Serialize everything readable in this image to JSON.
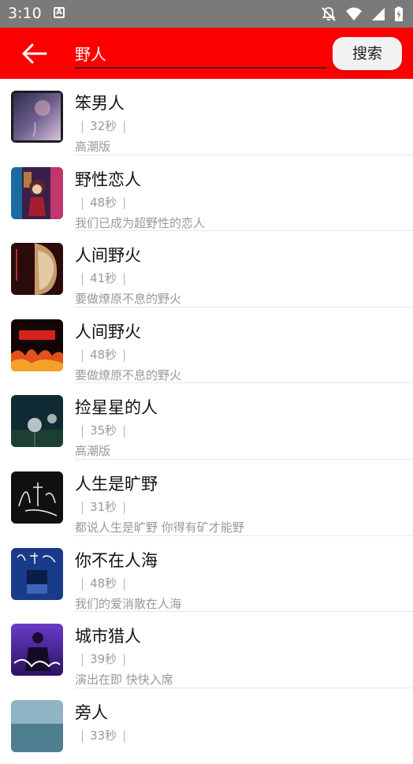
{
  "status_bar": {
    "time": "3:10",
    "a_badge": "A"
  },
  "search": {
    "query": "野人",
    "button_label": "搜索"
  },
  "songs": [
    {
      "title": "笨男人",
      "duration": "32秒",
      "subtitle": "高潮版",
      "cover_icon": "album-cover-purple-sky"
    },
    {
      "title": "野性恋人",
      "duration": "48秒",
      "subtitle": "我们已成为超野性的恋人",
      "cover_icon": "album-cover-anime-girl"
    },
    {
      "title": "人间野火",
      "duration": "41秒",
      "subtitle": "要做燎原不息的野火",
      "cover_icon": "album-cover-woman-fire"
    },
    {
      "title": "人间野火",
      "duration": "48秒",
      "subtitle": "要做燎原不息的野火",
      "cover_icon": "album-cover-red-fire"
    },
    {
      "title": "捡星星的人",
      "duration": "35秒",
      "subtitle": "高潮版",
      "cover_icon": "album-cover-dandelion"
    },
    {
      "title": "人生是旷野",
      "duration": "31秒",
      "subtitle": "都说人生是旷野  你得有矿才能野",
      "cover_icon": "album-cover-calligraphy"
    },
    {
      "title": "你不在人海",
      "duration": "48秒",
      "subtitle": "我们的爱消散在人海",
      "cover_icon": "album-cover-blue-sea"
    },
    {
      "title": "城市猎人",
      "duration": "39秒",
      "subtitle": "演出在即 快快入席",
      "cover_icon": "album-cover-city-hunter"
    },
    {
      "title": "旁人",
      "duration": "33秒",
      "subtitle": "",
      "cover_icon": "album-cover-ocean"
    }
  ]
}
